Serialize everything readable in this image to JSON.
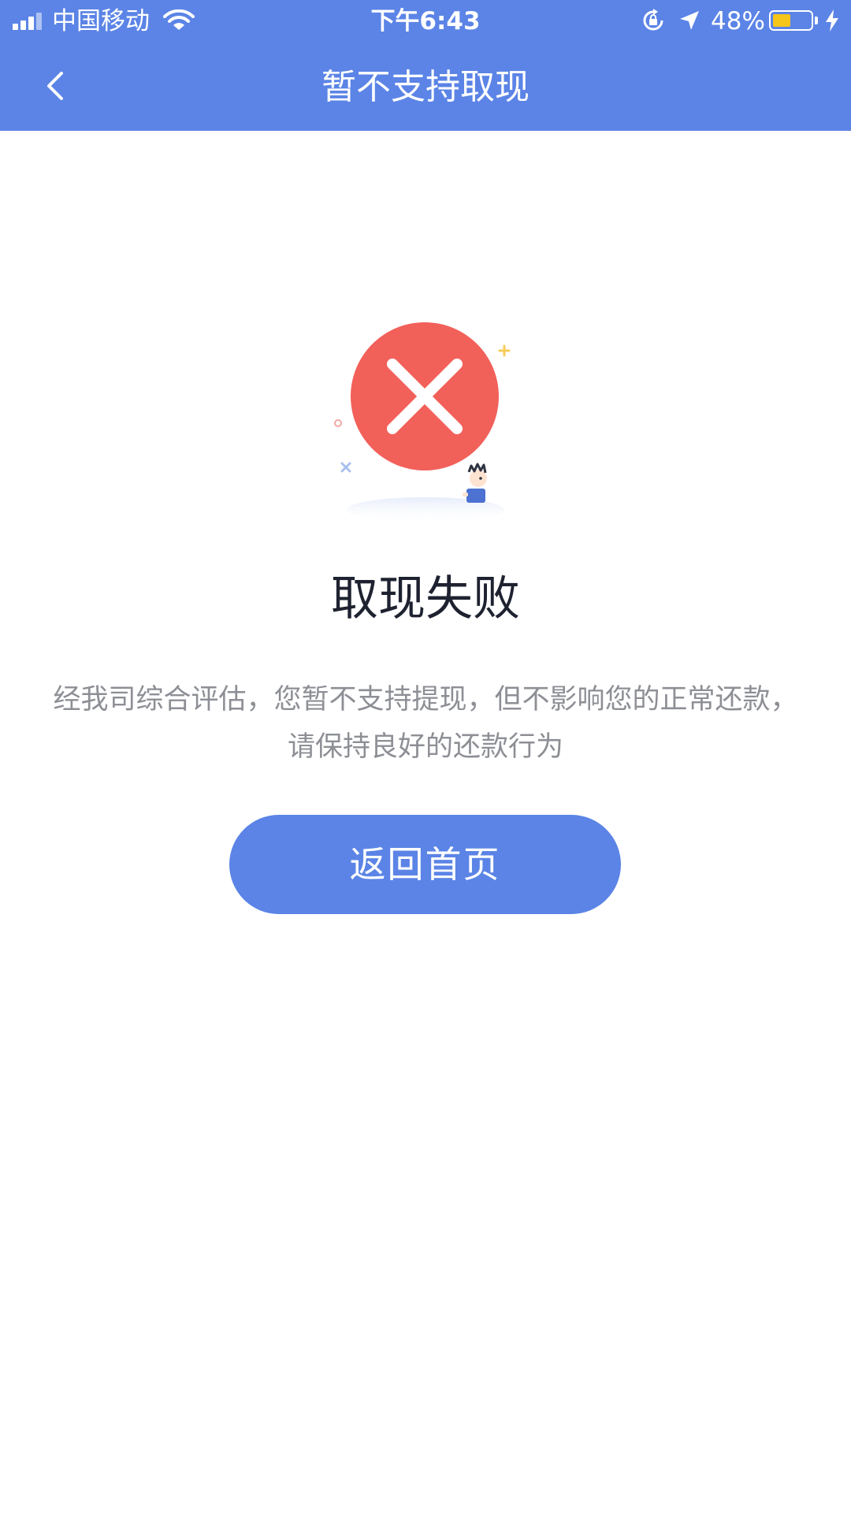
{
  "status_bar": {
    "carrier": "中国移动",
    "time": "下午6:43",
    "battery_percent_text": "48%",
    "battery_level": 0.48,
    "icons": [
      "signal-icon",
      "wifi-icon",
      "rotation-lock-icon",
      "location-icon",
      "battery-icon",
      "charging-icon"
    ]
  },
  "nav": {
    "title": "暂不支持取现",
    "back_icon": "chevron-left-icon"
  },
  "result": {
    "icon": "error-x-icon",
    "title": "取现失败",
    "description_line1": "经我司综合评估，您暂不支持提现，但不影响您的正常还款，",
    "description_line2": "请保持良好的还款行为"
  },
  "actions": {
    "home_button_label": "返回首页"
  },
  "colors": {
    "primary": "#5b84e6",
    "error": "#f2605a",
    "title_text": "#1e2230",
    "secondary_text": "#8d8f95",
    "battery": "#f5c518"
  }
}
